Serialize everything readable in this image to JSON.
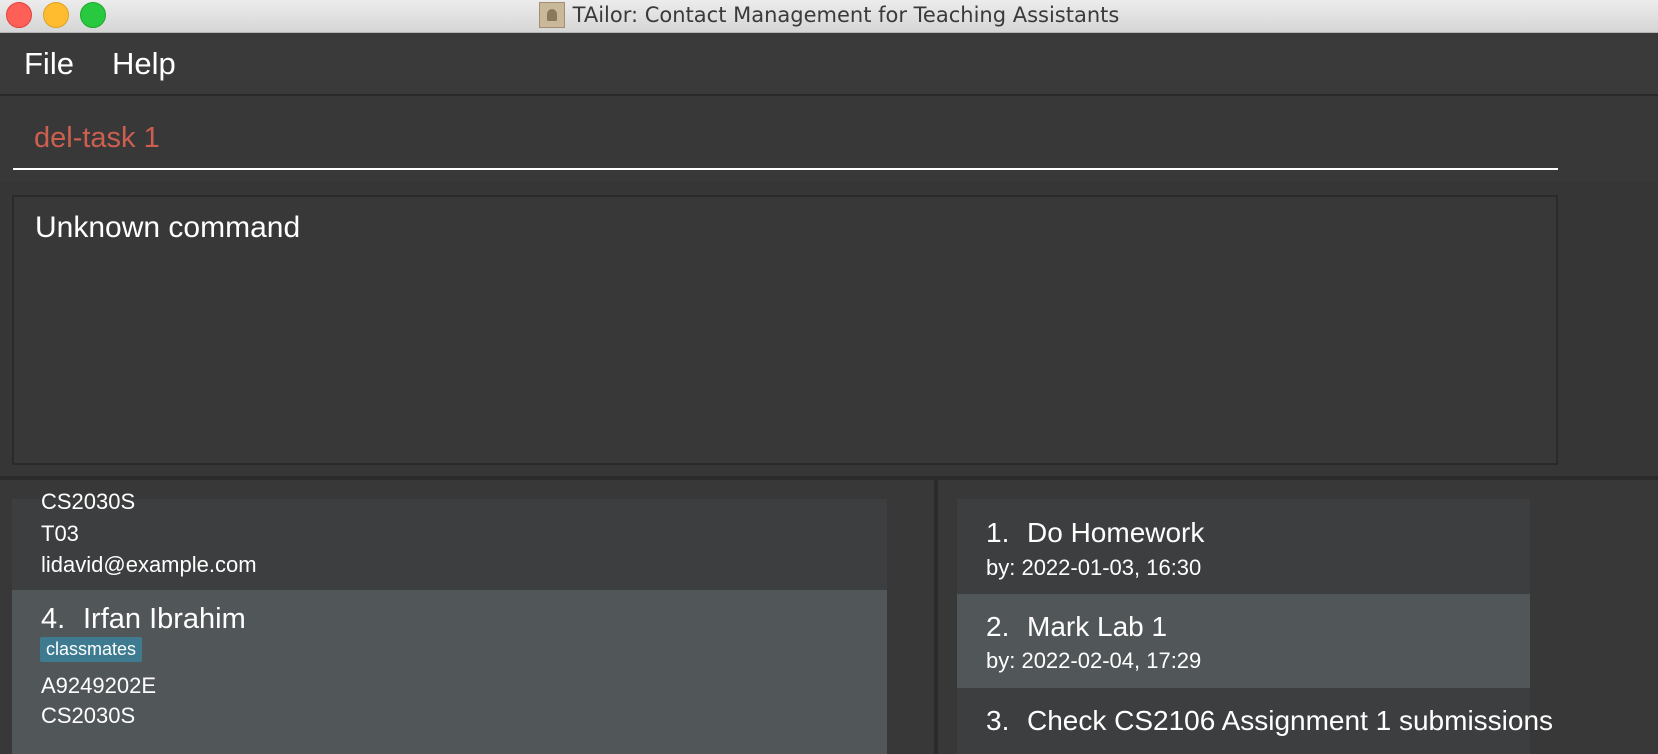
{
  "window": {
    "title": "TAilor: Contact Management for Teaching Assistants"
  },
  "menu": {
    "file": "File",
    "help": "Help"
  },
  "command": {
    "value": "del-task 1"
  },
  "result": {
    "message": "Unknown command"
  },
  "persons": [
    {
      "lines": [
        "CS2030S",
        "T03",
        "lidavid@example.com"
      ]
    },
    {
      "index": "4.",
      "name": "Irfan Ibrahim",
      "tag": "classmates",
      "lines": [
        "A9249202E",
        "CS2030S"
      ]
    }
  ],
  "tasks": [
    {
      "index": "1.",
      "title": "Do Homework",
      "deadline": "by: 2022-01-03, 16:30"
    },
    {
      "index": "2.",
      "title": "Mark Lab 1",
      "deadline": "by: 2022-02-04, 17:29"
    },
    {
      "index": "3.",
      "title": "Check CS2106 Assignment 1 submissions"
    }
  ],
  "colors": {
    "command_text": "#cd5f50",
    "tag_bg": "#3e7b91",
    "selected_row": "#515658"
  }
}
